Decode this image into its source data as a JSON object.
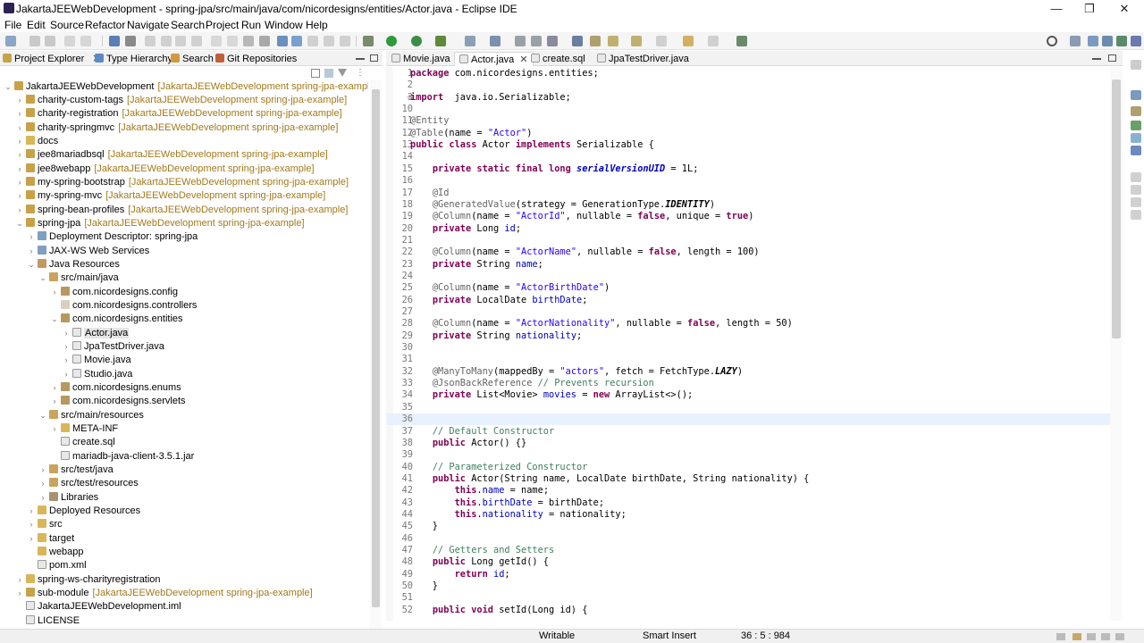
{
  "window": {
    "title": "JakartaJEEWebDevelopment - spring-jpa/src/main/java/com/nicordesigns/entities/Actor.java - Eclipse IDE",
    "minimize": "—",
    "maximize": "❐",
    "close": "✕"
  },
  "menu": [
    "File",
    "Edit",
    "Source",
    "Refactor",
    "Navigate",
    "Search",
    "Project",
    "Run",
    "Window",
    "Help"
  ],
  "left_tabs": [
    {
      "label": "Project Explorer",
      "close": "✕"
    },
    {
      "label": "Type Hierarchy"
    },
    {
      "label": "Search"
    },
    {
      "label": "Git Repositories"
    }
  ],
  "tree": [
    {
      "label": "JakartaJEEWebDevelopment",
      "deco": "[JakartaJEEWebDevelopment spring-jpa-example]",
      "twisty": "⌄"
    },
    {
      "label": "charity-custom-tags",
      "deco": "[JakartaJEEWebDevelopment spring-jpa-example]",
      "twisty": "›"
    },
    {
      "label": "charity-registration",
      "deco": "[JakartaJEEWebDevelopment spring-jpa-example]",
      "twisty": "›"
    },
    {
      "label": "charity-springmvc",
      "deco": "[JakartaJEEWebDevelopment spring-jpa-example]",
      "twisty": "›"
    },
    {
      "label": "docs",
      "deco": "",
      "twisty": "›"
    },
    {
      "label": "jee8mariadbsql",
      "deco": "[JakartaJEEWebDevelopment spring-jpa-example]",
      "twisty": "›"
    },
    {
      "label": "jee8webapp",
      "deco": "[JakartaJEEWebDevelopment spring-jpa-example]",
      "twisty": "›"
    },
    {
      "label": "my-spring-bootstrap",
      "deco": "[JakartaJEEWebDevelopment spring-jpa-example]",
      "twisty": "›"
    },
    {
      "label": "my-spring-mvc",
      "deco": "[JakartaJEEWebDevelopment spring-jpa-example]",
      "twisty": "›"
    },
    {
      "label": "spring-bean-profiles",
      "deco": "[JakartaJEEWebDevelopment spring-jpa-example]",
      "twisty": "›"
    },
    {
      "label": "spring-jpa",
      "deco": "[JakartaJEEWebDevelopment spring-jpa-example]",
      "twisty": "⌄"
    },
    {
      "label": "Deployment Descriptor: spring-jpa",
      "deco": "",
      "twisty": "›"
    },
    {
      "label": "JAX-WS Web Services",
      "deco": "",
      "twisty": "›"
    },
    {
      "label": "Java Resources",
      "deco": "",
      "twisty": "⌄"
    },
    {
      "label": "src/main/java",
      "deco": "",
      "twisty": "⌄"
    },
    {
      "label": "com.nicordesigns.config",
      "deco": "",
      "twisty": "›"
    },
    {
      "label": "com.nicordesigns.controllers",
      "deco": "",
      "twisty": ""
    },
    {
      "label": "com.nicordesigns.entities",
      "deco": "",
      "twisty": "⌄"
    },
    {
      "label": "Actor.java",
      "deco": "",
      "twisty": "›"
    },
    {
      "label": "JpaTestDriver.java",
      "deco": "",
      "twisty": "›"
    },
    {
      "label": "Movie.java",
      "deco": "",
      "twisty": "›"
    },
    {
      "label": "Studio.java",
      "deco": "",
      "twisty": "›"
    },
    {
      "label": "com.nicordesigns.enums",
      "deco": "",
      "twisty": "›"
    },
    {
      "label": "com.nicordesigns.servlets",
      "deco": "",
      "twisty": "›"
    },
    {
      "label": "src/main/resources",
      "deco": "",
      "twisty": "⌄"
    },
    {
      "label": "META-INF",
      "deco": "",
      "twisty": "›"
    },
    {
      "label": "create.sql",
      "deco": "",
      "twisty": ""
    },
    {
      "label": "mariadb-java-client-3.5.1.jar",
      "deco": "",
      "twisty": ""
    },
    {
      "label": "src/test/java",
      "deco": "",
      "twisty": "›"
    },
    {
      "label": "src/test/resources",
      "deco": "",
      "twisty": "›"
    },
    {
      "label": "Libraries",
      "deco": "",
      "twisty": "›"
    },
    {
      "label": "Deployed Resources",
      "deco": "",
      "twisty": "›"
    },
    {
      "label": "src",
      "deco": "",
      "twisty": "›"
    },
    {
      "label": "target",
      "deco": "",
      "twisty": "›"
    },
    {
      "label": "webapp",
      "deco": "",
      "twisty": ""
    },
    {
      "label": "pom.xml",
      "deco": "",
      "twisty": ""
    },
    {
      "label": "spring-ws-charityregistration",
      "deco": "",
      "twisty": "›"
    },
    {
      "label": "sub-module",
      "deco": "[JakartaJEEWebDevelopment spring-jpa-example]",
      "twisty": "›"
    },
    {
      "label": "JakartaJEEWebDevelopment.iml",
      "deco": "",
      "twisty": ""
    },
    {
      "label": "LICENSE",
      "deco": "",
      "twisty": ""
    }
  ],
  "editor_tabs": [
    {
      "label": "Movie.java"
    },
    {
      "label": "Actor.java",
      "close": "✕"
    },
    {
      "label": "create.sql"
    },
    {
      "label": "JpaTestDriver.java"
    }
  ],
  "code": [
    {
      "n": "1",
      "t": [
        [
          "kw",
          "package"
        ],
        [
          "",
          " com.nicordesigns.entities;"
        ]
      ]
    },
    {
      "n": "2",
      "t": []
    },
    {
      "n": "3",
      "t": [
        [
          "kw",
          "import"
        ],
        [
          "",
          "  java.io.Serializable;"
        ]
      ],
      "fold": "+"
    },
    {
      "n": "10",
      "t": []
    },
    {
      "n": "11",
      "t": [
        [
          "an",
          "@Entity"
        ]
      ]
    },
    {
      "n": "12",
      "t": [
        [
          "an",
          "@Table"
        ],
        [
          "",
          "(name = "
        ],
        [
          "str",
          "\"Actor\""
        ],
        [
          "",
          ")"
        ]
      ]
    },
    {
      "n": "13",
      "t": [
        [
          "kw",
          "public class"
        ],
        [
          "",
          " Actor "
        ],
        [
          "kw",
          "implements"
        ],
        [
          "",
          " Serializable {"
        ]
      ]
    },
    {
      "n": "14",
      "t": []
    },
    {
      "n": "15",
      "t": [
        [
          "",
          "    "
        ],
        [
          "kw",
          "private static final long"
        ],
        [
          "",
          " "
        ],
        [
          "sf",
          "serialVersionUID"
        ],
        [
          "",
          " = 1L;"
        ]
      ]
    },
    {
      "n": "16",
      "t": []
    },
    {
      "n": "17",
      "t": [
        [
          "",
          "    "
        ],
        [
          "an",
          "@Id"
        ]
      ],
      "fold": "-"
    },
    {
      "n": "18",
      "t": [
        [
          "",
          "    "
        ],
        [
          "an",
          "@GeneratedValue"
        ],
        [
          "",
          "(strategy = GenerationType."
        ],
        [
          "bi",
          "IDENTITY"
        ],
        [
          "",
          ")"
        ]
      ]
    },
    {
      "n": "19",
      "t": [
        [
          "",
          "    "
        ],
        [
          "an",
          "@Column"
        ],
        [
          "",
          "(name = "
        ],
        [
          "str",
          "\"ActorId\""
        ],
        [
          "",
          ", nullable = "
        ],
        [
          "kw",
          "false"
        ],
        [
          "",
          ", unique = "
        ],
        [
          "kw",
          "true"
        ],
        [
          "",
          ")"
        ]
      ]
    },
    {
      "n": "20",
      "t": [
        [
          "",
          "    "
        ],
        [
          "kw",
          "private"
        ],
        [
          "",
          " Long "
        ],
        [
          "fl",
          "id"
        ],
        [
          "",
          ";"
        ]
      ]
    },
    {
      "n": "21",
      "t": []
    },
    {
      "n": "22",
      "t": [
        [
          "",
          "    "
        ],
        [
          "an",
          "@Column"
        ],
        [
          "",
          "(name = "
        ],
        [
          "str",
          "\"ActorName\""
        ],
        [
          "",
          ", nullable = "
        ],
        [
          "kw",
          "false"
        ],
        [
          "",
          ", length = 100)"
        ]
      ],
      "fold": "-"
    },
    {
      "n": "23",
      "t": [
        [
          "",
          "    "
        ],
        [
          "kw",
          "private"
        ],
        [
          "",
          " String "
        ],
        [
          "fl",
          "name"
        ],
        [
          "",
          ";"
        ]
      ]
    },
    {
      "n": "24",
      "t": []
    },
    {
      "n": "25",
      "t": [
        [
          "",
          "    "
        ],
        [
          "an",
          "@Column"
        ],
        [
          "",
          "(name = "
        ],
        [
          "str",
          "\"ActorBirthDate\""
        ],
        [
          "",
          ")"
        ]
      ],
      "fold": "-"
    },
    {
      "n": "26",
      "t": [
        [
          "",
          "    "
        ],
        [
          "kw",
          "private"
        ],
        [
          "",
          " LocalDate "
        ],
        [
          "fl",
          "birthDate"
        ],
        [
          "",
          ";"
        ]
      ]
    },
    {
      "n": "27",
      "t": []
    },
    {
      "n": "28",
      "t": [
        [
          "",
          "    "
        ],
        [
          "an",
          "@Column"
        ],
        [
          "",
          "(name = "
        ],
        [
          "str",
          "\"ActorNationality\""
        ],
        [
          "",
          ", nullable = "
        ],
        [
          "kw",
          "false"
        ],
        [
          "",
          ", length = 50)"
        ]
      ],
      "fold": "-"
    },
    {
      "n": "29",
      "t": [
        [
          "",
          "    "
        ],
        [
          "kw",
          "private"
        ],
        [
          "",
          " String "
        ],
        [
          "fl",
          "nationality"
        ],
        [
          "",
          ";"
        ]
      ]
    },
    {
      "n": "30",
      "t": []
    },
    {
      "n": "31",
      "t": []
    },
    {
      "n": "32",
      "t": [
        [
          "",
          "    "
        ],
        [
          "an",
          "@ManyToMany"
        ],
        [
          "",
          "(mappedBy = "
        ],
        [
          "str",
          "\"actors\""
        ],
        [
          "",
          ", fetch = FetchType."
        ],
        [
          "bi",
          "LAZY"
        ],
        [
          "",
          ")"
        ]
      ],
      "fold": "-"
    },
    {
      "n": "33",
      "t": [
        [
          "",
          "    "
        ],
        [
          "an",
          "@JsonBackReference"
        ],
        [
          "",
          " "
        ],
        [
          "cm",
          "// Prevents recursion"
        ]
      ]
    },
    {
      "n": "34",
      "t": [
        [
          "",
          "    "
        ],
        [
          "kw",
          "private"
        ],
        [
          "",
          " List<Movie> "
        ],
        [
          "fl",
          "movies"
        ],
        [
          "",
          " = "
        ],
        [
          "kw",
          "new"
        ],
        [
          "",
          " ArrayList<>();"
        ]
      ]
    },
    {
      "n": "35",
      "t": []
    },
    {
      "n": "36",
      "t": [],
      "cur": true
    },
    {
      "n": "37",
      "t": [
        [
          "",
          "    "
        ],
        [
          "cm",
          "// Default Constructor"
        ]
      ]
    },
    {
      "n": "38",
      "t": [
        [
          "",
          "    "
        ],
        [
          "kw",
          "public"
        ],
        [
          "",
          " Actor() {}"
        ]
      ]
    },
    {
      "n": "39",
      "t": []
    },
    {
      "n": "40",
      "t": [
        [
          "",
          "    "
        ],
        [
          "cm",
          "// Parameterized Constructor"
        ]
      ]
    },
    {
      "n": "41",
      "t": [
        [
          "",
          "    "
        ],
        [
          "kw",
          "public"
        ],
        [
          "",
          " Actor(String name, LocalDate birthDate, String nationality) {"
        ]
      ],
      "fold": "-"
    },
    {
      "n": "42",
      "t": [
        [
          "",
          "        "
        ],
        [
          "kw",
          "this"
        ],
        [
          "",
          "."
        ],
        [
          "fl",
          "name"
        ],
        [
          "",
          " = name;"
        ]
      ]
    },
    {
      "n": "43",
      "t": [
        [
          "",
          "        "
        ],
        [
          "kw",
          "this"
        ],
        [
          "",
          "."
        ],
        [
          "fl",
          "birthDate"
        ],
        [
          "",
          " = birthDate;"
        ]
      ]
    },
    {
      "n": "44",
      "t": [
        [
          "",
          "        "
        ],
        [
          "kw",
          "this"
        ],
        [
          "",
          "."
        ],
        [
          "fl",
          "nationality"
        ],
        [
          "",
          " = nationality;"
        ]
      ]
    },
    {
      "n": "45",
      "t": [
        [
          "",
          "    }"
        ]
      ]
    },
    {
      "n": "46",
      "t": []
    },
    {
      "n": "47",
      "t": [
        [
          "",
          "    "
        ],
        [
          "cm",
          "// Getters and Setters"
        ]
      ]
    },
    {
      "n": "48",
      "t": [
        [
          "",
          "    "
        ],
        [
          "kw",
          "public"
        ],
        [
          "",
          " Long getId() {"
        ]
      ],
      "fold": "-"
    },
    {
      "n": "49",
      "t": [
        [
          "",
          "        "
        ],
        [
          "kw",
          "return"
        ],
        [
          "",
          " "
        ],
        [
          "fl",
          "id"
        ],
        [
          "",
          ";"
        ]
      ]
    },
    {
      "n": "50",
      "t": [
        [
          "",
          "    }"
        ]
      ]
    },
    {
      "n": "51",
      "t": []
    },
    {
      "n": "52",
      "t": [
        [
          "",
          "    "
        ],
        [
          "kw",
          "public void"
        ],
        [
          "",
          " setId(Long id) {"
        ]
      ],
      "fold": "-"
    }
  ],
  "status": {
    "writable": "Writable",
    "insert_mode": "Smart Insert",
    "position": "36 : 5 : 984"
  },
  "colors": {
    "keyword": "#7f0055",
    "string": "#2a00ff",
    "comment": "#3f7f5f",
    "annotation": "#646464",
    "field": "#0000c0",
    "current_line": "#e8f2fe"
  }
}
